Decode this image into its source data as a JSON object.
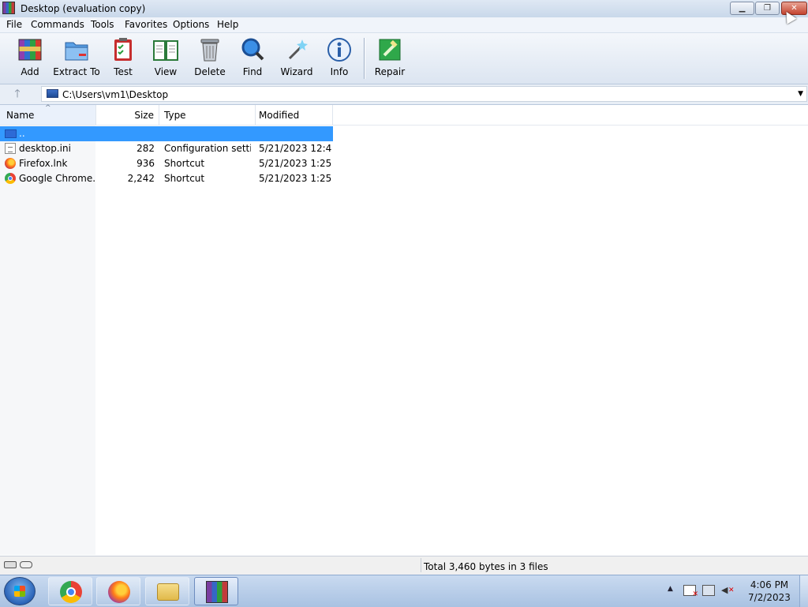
{
  "window": {
    "title": "Desktop (evaluation copy)",
    "controls": {
      "minimize": "▁",
      "maximize": "❐",
      "close": "✕"
    }
  },
  "menu": [
    "File",
    "Commands",
    "Tools",
    "Favorites",
    "Options",
    "Help"
  ],
  "toolbar": [
    {
      "label": "Add",
      "icon": "add-archive-icon"
    },
    {
      "label": "Extract To",
      "icon": "extract-folder-icon"
    },
    {
      "label": "Test",
      "icon": "test-clipboard-icon"
    },
    {
      "label": "View",
      "icon": "view-book-icon"
    },
    {
      "label": "Delete",
      "icon": "trash-icon"
    },
    {
      "label": "Find",
      "icon": "magnifier-icon"
    },
    {
      "label": "Wizard",
      "icon": "wand-icon"
    },
    {
      "label": "Info",
      "icon": "info-icon"
    },
    {
      "label": "Repair",
      "icon": "repair-icon"
    }
  ],
  "address": {
    "path": "C:\\Users\\vm1\\Desktop",
    "up_arrow": "🡑",
    "dropdown": "▼"
  },
  "columns": {
    "name": "Name",
    "size": "Size",
    "type": "Type",
    "modified": "Modified",
    "sort_indicator": "^"
  },
  "files": [
    {
      "name": "..",
      "size": "",
      "type": "",
      "modified": "",
      "icon": "parent-folder-icon",
      "selected": true
    },
    {
      "name": "desktop.ini",
      "size": "282",
      "type": "Configuration setti...",
      "modified": "5/21/2023 12:4...",
      "icon": "ini-file-icon"
    },
    {
      "name": "Firefox.lnk",
      "size": "936",
      "type": "Shortcut",
      "modified": "5/21/2023 1:25 ...",
      "icon": "firefox-icon"
    },
    {
      "name": "Google Chrome....",
      "size": "2,242",
      "type": "Shortcut",
      "modified": "5/21/2023 1:25 ...",
      "icon": "chrome-icon"
    }
  ],
  "status": {
    "summary": "Total 3,460 bytes in 3 files"
  },
  "taskbar": {
    "apps": [
      "chrome",
      "firefox",
      "file-explorer",
      "winrar"
    ],
    "clock_time": "4:06 PM",
    "clock_date": "7/2/2023",
    "tray_arrow": "▲"
  }
}
